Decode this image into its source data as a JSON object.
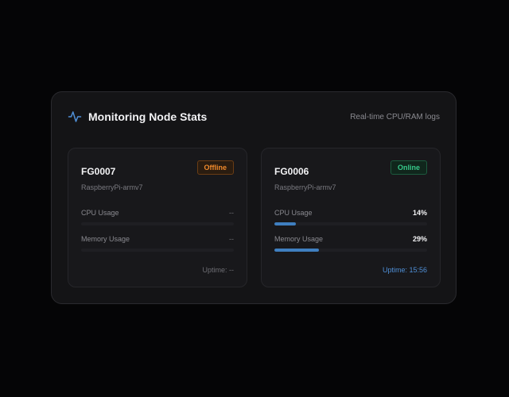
{
  "header": {
    "icon": "activity-icon",
    "title": "Monitoring Node Stats",
    "subtitle": "Real-time CPU/RAM logs"
  },
  "colors": {
    "accent": "#4f8fd6",
    "bar": "#3f7fc0",
    "offline": "#f08a2c",
    "online": "#37c98a"
  },
  "nodes": [
    {
      "id": "FG0007",
      "status": "Offline",
      "platform": "RaspberryPi-armv7",
      "cpu_label": "CPU Usage",
      "cpu_value": "--",
      "cpu_fraction": 0,
      "memory_label": "Memory Usage",
      "memory_value": "--",
      "memory_fraction": 0,
      "uptime": "Uptime: --"
    },
    {
      "id": "FG0006",
      "status": "Online",
      "platform": "RaspberryPi-armv7",
      "cpu_label": "CPU Usage",
      "cpu_value": "14%",
      "cpu_fraction": 0.14,
      "memory_label": "Memory Usage",
      "memory_value": "29%",
      "memory_fraction": 0.29,
      "uptime": "Uptime: 15:56"
    }
  ]
}
